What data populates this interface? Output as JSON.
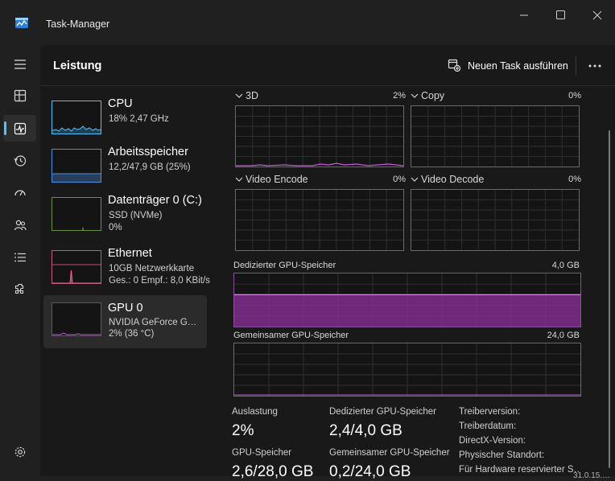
{
  "window": {
    "title": "Task-Manager"
  },
  "header": {
    "title": "Leistung",
    "new_task_label": "Neuen Task ausführen"
  },
  "colors": {
    "cpu": "#4cc2ff",
    "memory": "#4b8fe0",
    "disk": "#8cc63f",
    "network": "#ff5f8f",
    "gpu": "#c05ad8",
    "accent": "#4cc2ff"
  },
  "perf_items": [
    {
      "title": "CPU",
      "line1": "18% 2,47 GHz",
      "line2": ""
    },
    {
      "title": "Arbeitsspeicher",
      "line1": "12,2/47,9 GB (25%)",
      "line2": ""
    },
    {
      "title": "Datenträger 0 (C:)",
      "line1": "SSD (NVMe)",
      "line2": "0%"
    },
    {
      "title": "Ethernet",
      "line1": "10GB Netzwerkkarte",
      "line2": "Ges.: 0 Empf.: 8,0 KBit/s"
    },
    {
      "title": "GPU 0",
      "line1": "NVIDIA GeForce G…",
      "line2": "2% (36 °C)"
    }
  ],
  "gpu": {
    "engines": [
      {
        "name": "3D",
        "value": "2%"
      },
      {
        "name": "Copy",
        "value": "0%"
      },
      {
        "name": "Video Encode",
        "value": "0%"
      },
      {
        "name": "Video Decode",
        "value": "0%"
      }
    ],
    "dedicated_label": "Dedizierter GPU-Speicher",
    "dedicated_max": "4,0 GB",
    "dedicated_fill": 0.6,
    "shared_label": "Gemeinsamer GPU-Speicher",
    "shared_max": "24,0 GB",
    "stats": {
      "utilization_label": "Auslastung",
      "utilization_value": "2%",
      "dedicated_label": "Dedizierter GPU-Speicher",
      "dedicated_value": "2,4/4,0 GB",
      "gpu_memory_label": "GPU-Speicher",
      "gpu_memory_value": "2,6/28,0 GB",
      "shared_label": "Gemeinsamer GPU-Speicher",
      "shared_value": "0,2/24,0 GB"
    },
    "info": [
      "Treiberversion:",
      "Treiberdatum:",
      "DirectX-Version:",
      "Physischer Standort:",
      "Für Hardware reservierter S…"
    ],
    "info_value_partial": "31.0.15.…"
  },
  "rail_icons": [
    "hamburger-menu-icon",
    "processes-icon",
    "performance-icon",
    "app-history-icon",
    "startup-apps-icon",
    "users-icon",
    "details-icon",
    "services-icon",
    "settings-icon"
  ]
}
